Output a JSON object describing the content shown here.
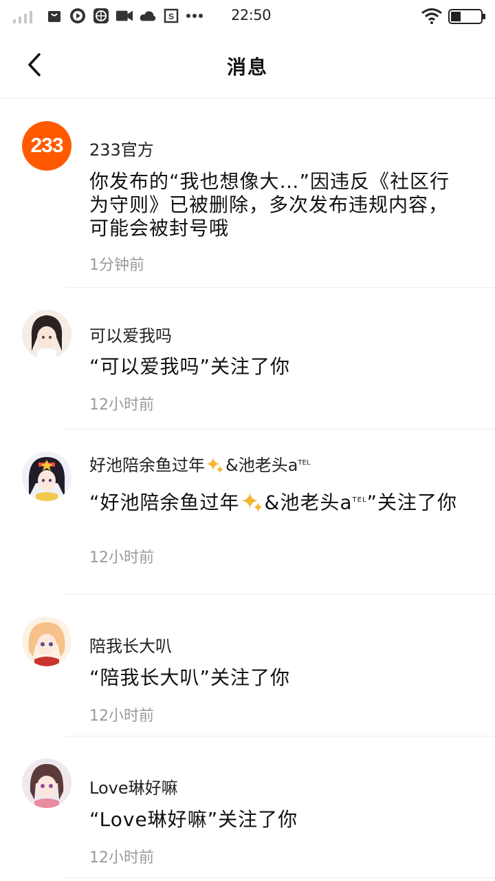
{
  "status_bar": {
    "time": "22:50",
    "icons": [
      "signal-icon",
      "bag-icon",
      "video-play-icon",
      "globe-icon",
      "camera-icon",
      "cloud-icon",
      "s-app-icon",
      "more-dots-icon",
      "wifi-icon",
      "battery-icon"
    ]
  },
  "header": {
    "title": "消息",
    "back_icon": "back-arrow-icon"
  },
  "messages": [
    {
      "sender": "233官方",
      "avatar_text": "233",
      "content": "你发布的“我也想像大…”因违反《社区行为守则》已被删除，多次发布违规内容，可能会被封号哦",
      "time": "1分钟前"
    },
    {
      "sender": "可以爱我吗",
      "content": "“可以爱我吗”关注了你",
      "time": "12小时前"
    },
    {
      "sender_prefix": "好池陪余鱼过年",
      "sender_suffix": "&池老头a",
      "sender_sup": "TEL",
      "content_prefix": "“好池陪余鱼过年",
      "content_suffix": "&池老头a",
      "content_sup": "TEL",
      "content_end": "”关注了你",
      "time": "12小时前"
    },
    {
      "sender": "陪我长大叭",
      "content": "“陪我长大叭”关注了你",
      "time": "12小时前"
    },
    {
      "sender": "Love琳好嘛",
      "content": "“Love琳好嘛”关注了你",
      "time": "12小时前"
    }
  ],
  "colors": {
    "brand_orange": "#ff5a00",
    "time_gray": "#9a9a9a",
    "divider": "#ececec"
  }
}
